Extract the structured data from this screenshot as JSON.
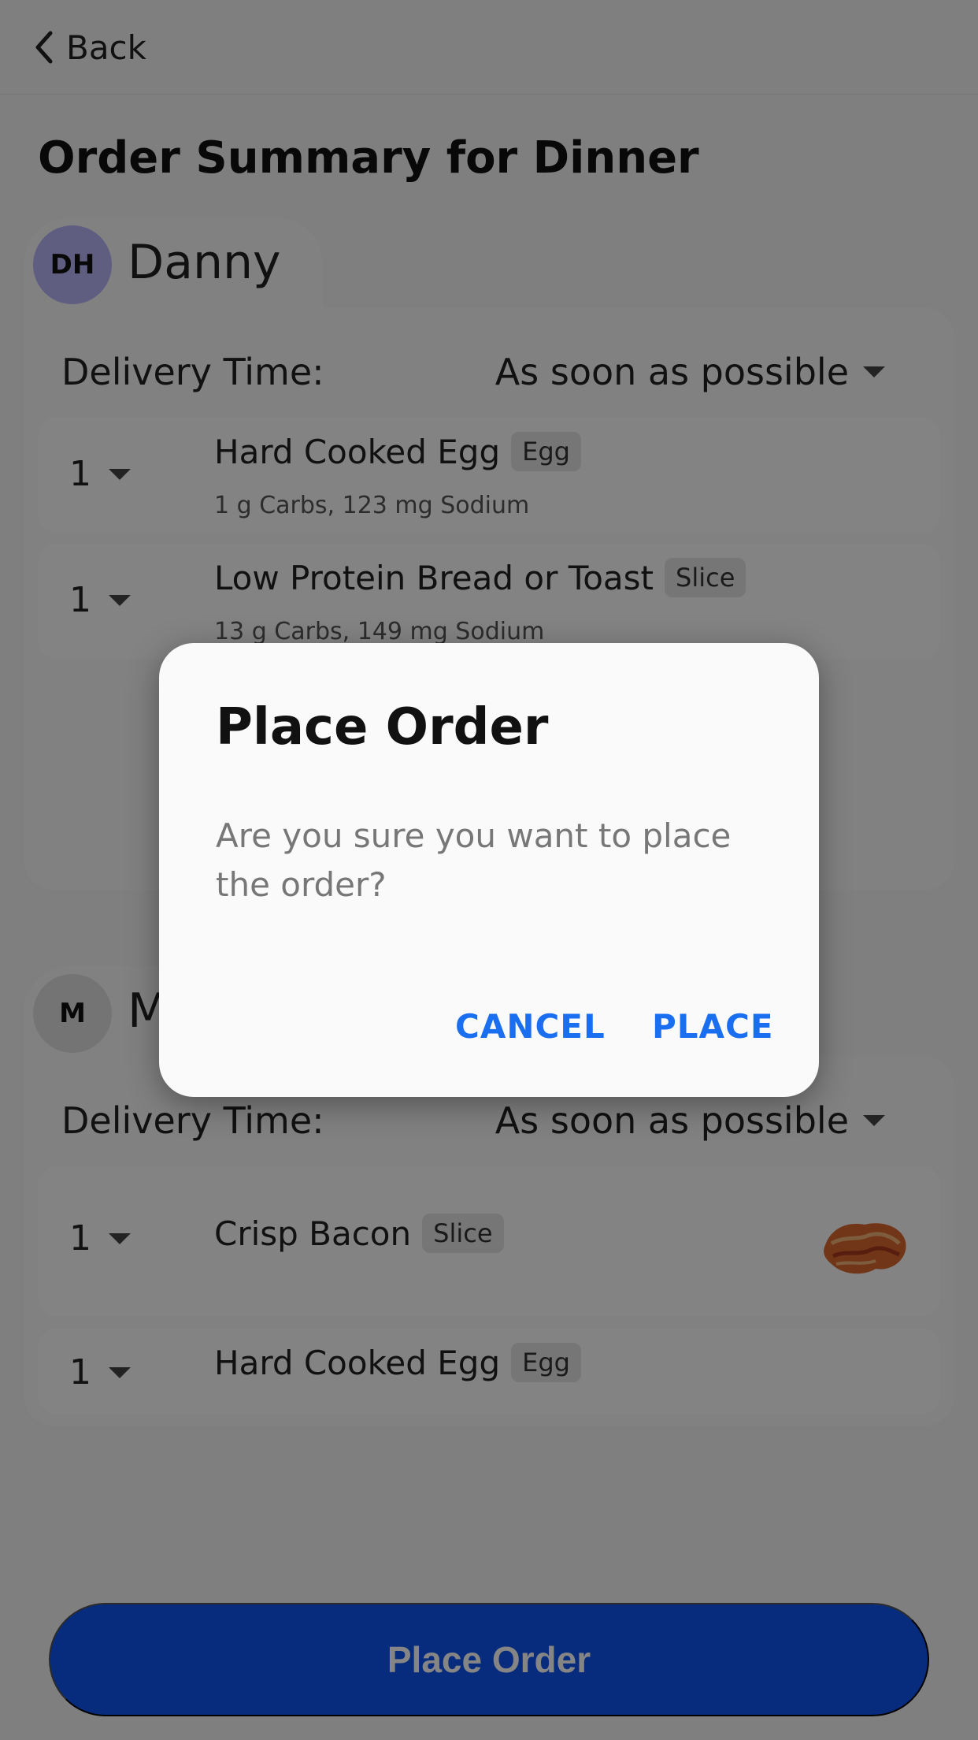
{
  "nav": {
    "back_label": "Back"
  },
  "page": {
    "title": "Order Summary for Dinner"
  },
  "orders": [
    {
      "initials": "DH",
      "name": "Danny",
      "avatar_color": "#b7b3f6",
      "delivery_label": "Delivery Time:",
      "delivery_value": "As soon as possible",
      "items": [
        {
          "qty": "1",
          "name": "Hard Cooked Egg",
          "unit": "Egg",
          "nutrition": "1 g Carbs, 123 mg Sodium"
        },
        {
          "qty": "1",
          "name": "Low Protein Bread or Toast",
          "unit": "Slice",
          "nutrition": "13 g Carbs, 149 mg Sodium"
        }
      ]
    },
    {
      "initials": "M",
      "name": "M",
      "avatar_color": "#dedede",
      "delivery_label": "Delivery Time:",
      "delivery_value": "As soon as possible",
      "items": [
        {
          "qty": "1",
          "name": "Crisp Bacon",
          "unit": "Slice",
          "image_icon": "bacon-image"
        },
        {
          "qty": "1",
          "name": "Hard Cooked Egg",
          "unit": "Egg"
        }
      ]
    }
  ],
  "footer": {
    "place_order_label": "Place Order",
    "button_color": "#0f55f2"
  },
  "dialog": {
    "title": "Place Order",
    "message": "Are you sure you want to place the order?",
    "cancel_label": "CANCEL",
    "confirm_label": "PLACE",
    "action_color": "#1a6ff0"
  }
}
